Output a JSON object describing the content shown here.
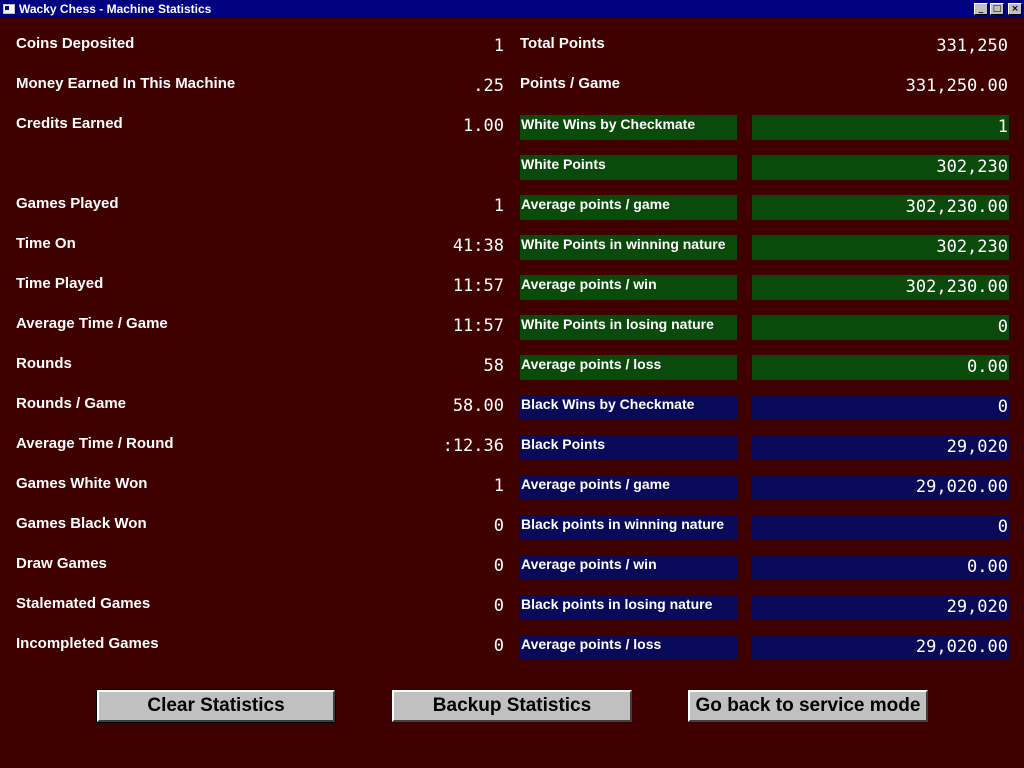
{
  "window": {
    "title": "Wacky Chess - Machine Statistics",
    "controls": {
      "minimize": "_",
      "maximize": "□",
      "close": "×"
    }
  },
  "general": {
    "coins_deposited": {
      "label": "Coins Deposited",
      "value": "1"
    },
    "money_earned": {
      "label": "Money Earned In This Machine",
      "value": ".25"
    },
    "credits_earned": {
      "label": "Credits Earned",
      "value": "1.00"
    },
    "games_played": {
      "label": "Games Played",
      "value": "1"
    },
    "time_on": {
      "label": "Time On",
      "value": "41:38"
    },
    "time_played": {
      "label": "Time Played",
      "value": "11:57"
    },
    "avg_time_game": {
      "label": "Average Time / Game",
      "value": "11:57"
    },
    "rounds": {
      "label": "Rounds",
      "value": "58"
    },
    "rounds_game": {
      "label": "Rounds / Game",
      "value": "58.00"
    },
    "avg_time_round": {
      "label": "Average Time / Round",
      "value": ":12.36"
    },
    "games_white_won": {
      "label": "Games White Won",
      "value": "1"
    },
    "games_black_won": {
      "label": "Games Black Won",
      "value": "0"
    },
    "draw_games": {
      "label": "Draw Games",
      "value": "0"
    },
    "stalemated_games": {
      "label": "Stalemated Games",
      "value": "0"
    },
    "incompleted_games": {
      "label": "Incompleted Games",
      "value": "0"
    }
  },
  "totals": {
    "total_points": {
      "label": "Total Points",
      "value": "331,250"
    },
    "points_game": {
      "label": "Points / Game",
      "value": "331,250.00"
    }
  },
  "white": {
    "wins_checkmate": {
      "label": "White Wins by Checkmate",
      "value": "1"
    },
    "points": {
      "label": "White Points",
      "value": "302,230"
    },
    "avg_points_game": {
      "label": "Average points / game",
      "value": "302,230.00"
    },
    "points_winning": {
      "label": "White Points in winning nature",
      "value": "302,230"
    },
    "avg_points_win": {
      "label": "Average points / win",
      "value": "302,230.00"
    },
    "points_losing": {
      "label": "White Points in losing nature",
      "value": "0"
    },
    "avg_points_loss": {
      "label": "Average points / loss",
      "value": "0.00"
    }
  },
  "black": {
    "wins_checkmate": {
      "label": "Black Wins by Checkmate",
      "value": "0"
    },
    "points": {
      "label": "Black Points",
      "value": "29,020"
    },
    "avg_points_game": {
      "label": "Average points / game",
      "value": "29,020.00"
    },
    "points_winning": {
      "label": "Black points in winning nature",
      "value": "0"
    },
    "avg_points_win": {
      "label": "Average points / win",
      "value": "0.00"
    },
    "points_losing": {
      "label": "Black points in losing nature",
      "value": "29,020"
    },
    "avg_points_loss": {
      "label": "Average points / loss",
      "value": "29,020.00"
    }
  },
  "buttons": {
    "clear": "Clear Statistics",
    "backup": "Backup Statistics",
    "service": "Go back to service mode"
  },
  "colors": {
    "background": "#3f0000",
    "white_side": "#0a4a0a",
    "black_side": "#0a0a5a",
    "titlebar": "#000080"
  }
}
